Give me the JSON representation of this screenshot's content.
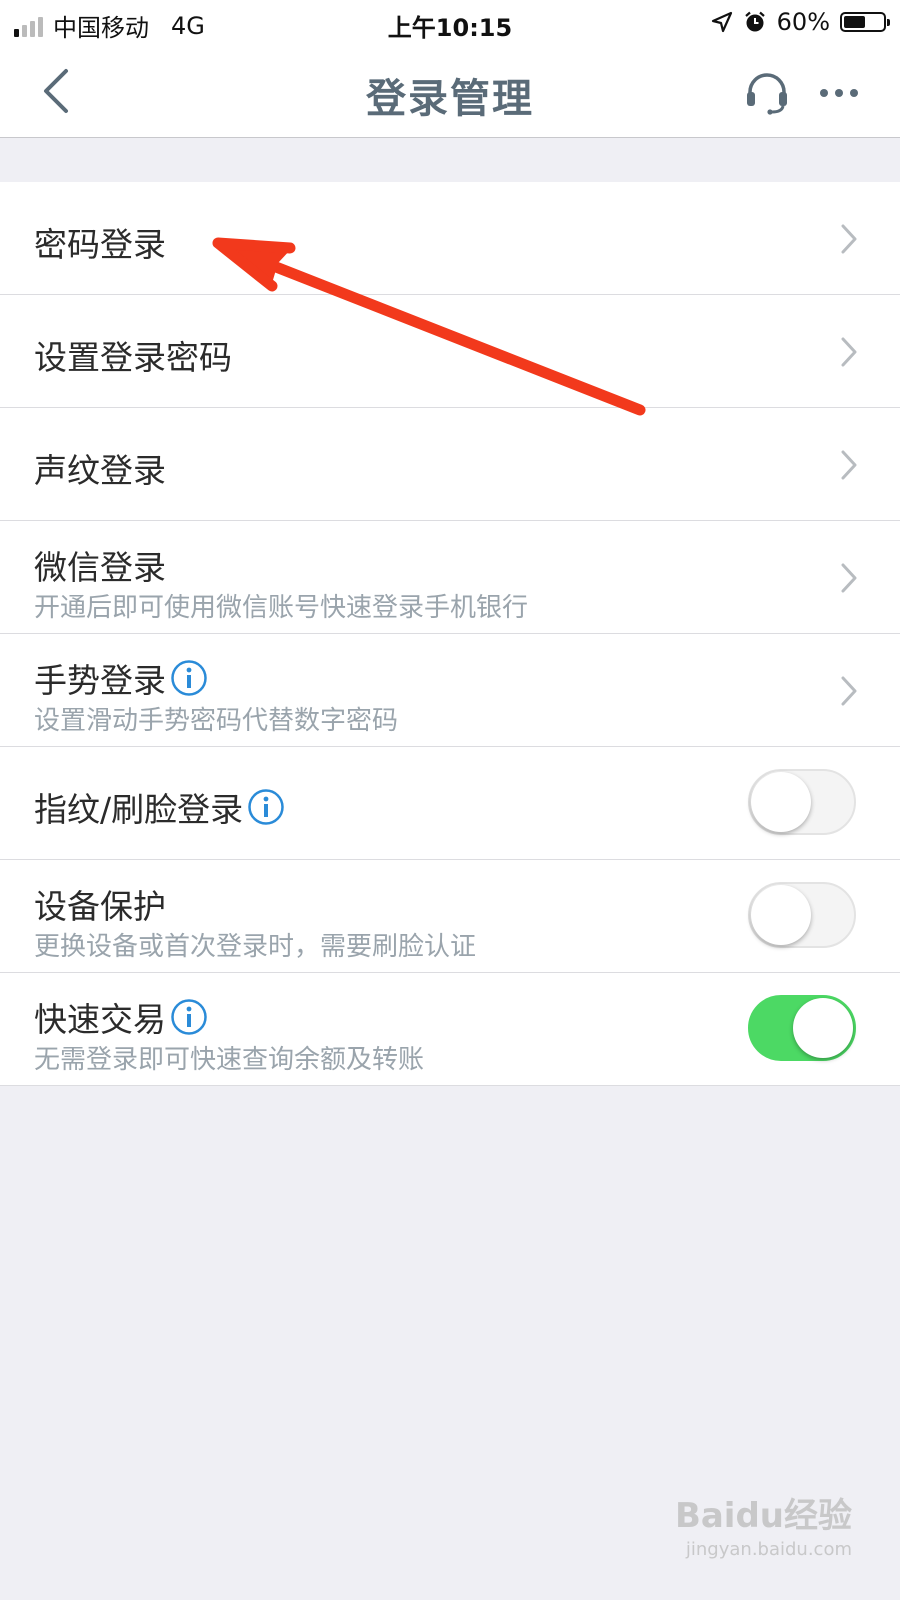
{
  "status_bar": {
    "carrier": "中国移动",
    "network": "4G",
    "time": "上午10:15",
    "battery_percent": "60%",
    "battery_level": 0.6,
    "signal_bars_active": 1,
    "signal_bars_total": 4,
    "icons": [
      "location-arrow-icon",
      "alarm-icon",
      "battery-icon"
    ]
  },
  "nav": {
    "title": "登录管理",
    "back_icon": "chevron-left-icon",
    "service_icon": "headset-icon",
    "more_icon": "more-dots-icon"
  },
  "settings": [
    {
      "id": "password-login",
      "title": "密码登录",
      "subtitle": "",
      "info": false,
      "control": "chevron"
    },
    {
      "id": "set-login-password",
      "title": "设置登录密码",
      "subtitle": "",
      "info": false,
      "control": "chevron"
    },
    {
      "id": "voiceprint-login",
      "title": "声纹登录",
      "subtitle": "",
      "info": false,
      "control": "chevron"
    },
    {
      "id": "wechat-login",
      "title": "微信登录",
      "subtitle": "开通后即可使用微信账号快速登录手机银行",
      "info": false,
      "control": "chevron"
    },
    {
      "id": "gesture-login",
      "title": "手势登录",
      "subtitle": "设置滑动手势密码代替数字密码",
      "info": true,
      "control": "chevron"
    },
    {
      "id": "fingerprint-face-login",
      "title": "指纹/刷脸登录",
      "subtitle": "",
      "info": true,
      "control": "toggle",
      "on": false
    },
    {
      "id": "device-protection",
      "title": "设备保护",
      "subtitle": "更换设备或首次登录时，需要刷脸认证",
      "info": false,
      "control": "toggle",
      "on": false
    },
    {
      "id": "quick-transaction",
      "title": "快速交易",
      "subtitle": "无需登录即可快速查询余额及转账",
      "info": true,
      "control": "toggle",
      "on": true
    }
  ],
  "colors": {
    "accent_info": "#2a8bd8",
    "toggle_on": "#4cd964",
    "annotation_arrow": "#f2391c",
    "title_text": "#5a6b78"
  },
  "watermark": {
    "logo": "Baidu经验",
    "url": "jingyan.baidu.com"
  }
}
